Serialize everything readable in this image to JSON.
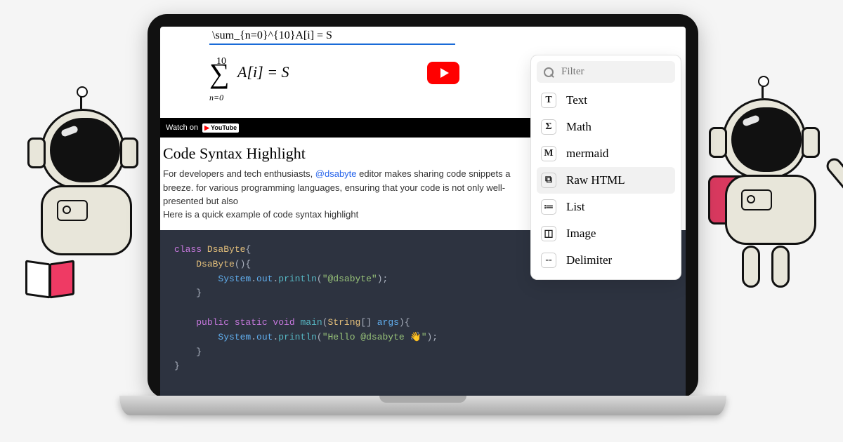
{
  "math_input": "\\sum_{n=0}^{10}A[i] = S",
  "math_render": {
    "upper": "10",
    "lower": "n=0",
    "body": "A[i] = S"
  },
  "youtube": {
    "watch_label": "Watch on",
    "brand": "YouTube"
  },
  "heading": "Code Syntax Highlight",
  "paragraph1_pre": "For developers and tech enthusiasts, ",
  "paragraph1_link": "@dsabyte",
  "paragraph1_post": " editor makes sharing code snippets a breeze. for various programming languages, ensuring that your code is not only well-presented but also",
  "paragraph2": "Here is a quick example of code syntax highlight",
  "code": {
    "l1_kw": "class",
    "l1_cls": "DsaByte",
    "l2_ctor": "DsaByte",
    "l3_sys": "System",
    "l3_out": "out",
    "l3_fn": "println",
    "l3_str": "\"@dsabyte\"",
    "l5_mods": "public static void",
    "l5_main": "main",
    "l5_argty": "String",
    "l5_argnm": "args",
    "l6_str": "\"Hello @dsabyte 👋\""
  },
  "popup": {
    "filter_placeholder": "Filter",
    "items": [
      {
        "icon": "T",
        "label": "Text"
      },
      {
        "icon": "Σ",
        "label": "Math"
      },
      {
        "icon": "M",
        "label": "mermaid"
      },
      {
        "icon": "⧉",
        "label": "Raw HTML",
        "selected": true
      },
      {
        "icon": "≔",
        "label": "List"
      },
      {
        "icon": "◫",
        "label": "Image"
      },
      {
        "icon": "--",
        "label": "Delimiter"
      }
    ]
  }
}
